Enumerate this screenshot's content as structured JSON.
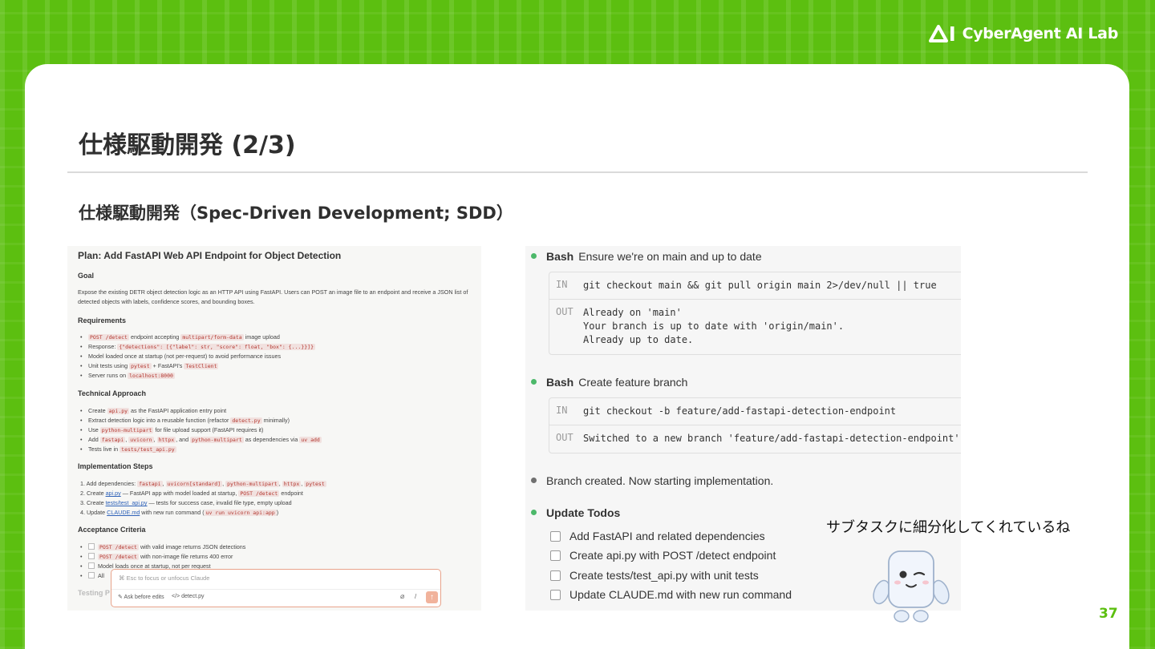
{
  "brand": {
    "logo_text": "CyberAgent AI Lab",
    "accent_color": "#5cbf10"
  },
  "slide": {
    "title": "仕様駆動開発 (2/3)",
    "subtitle": "仕様駆動開発（Spec-Driven Development; SDD）",
    "comment": "サブタスクに細分化してくれているね",
    "page_number": "37"
  },
  "plan": {
    "title": "Plan: Add FastAPI Web API Endpoint for Object Detection",
    "goal_heading": "Goal",
    "goal_text": "Expose the existing DETR object detection logic as an HTTP API using FastAPI. Users can POST an image file to an endpoint and receive a JSON list of detected objects with labels, confidence scores, and bounding boxes.",
    "requirements_heading": "Requirements",
    "technical_heading": "Technical Approach",
    "steps_heading": "Implementation Steps",
    "acceptance_heading": "Acceptance Criteria",
    "testing_heading_partial": "Testing P",
    "req1_code1": "POST /detect",
    "req1_text1": " endpoint accepting ",
    "req1_code2": "multipart/form-data",
    "req1_text2": " image upload",
    "req2_text": "Response: ",
    "req2_code": "{\"detections\": [{\"label\": str, \"score\": float, \"box\": {...}}]}",
    "req3_text": "Model loaded once at startup (not per-request) to avoid performance issues",
    "req4_text1": "Unit tests using ",
    "req4_code1": "pytest",
    "req4_text2": " + FastAPI's ",
    "req4_code2": "TestClient",
    "req5_text": "Server runs on ",
    "req5_code": "localhost:8000",
    "tech1_t1": "Create ",
    "tech1_c1": "api.py",
    "tech1_t2": " as the FastAPI application entry point",
    "tech2_t1": "Extract detection logic into a reusable function (refactor ",
    "tech2_c1": "detect.py",
    "tech2_t2": " minimally)",
    "tech3_t1": "Use ",
    "tech3_c1": "python-multipart",
    "tech3_t2": " for file upload support (FastAPI requires it)",
    "tech4_t1": "Add ",
    "tech4_c1": "fastapi",
    "tech4_c2": "uvicorn",
    "tech4_c3": "httpx",
    "tech4_t2": ", and ",
    "tech4_c4": "python-multipart",
    "tech4_t3": " as dependencies via ",
    "tech4_c5": "uv add",
    "tech5_t1": "Tests live in ",
    "tech5_c1": "tests/test_api.py",
    "step1_t1": "1. Add dependencies: ",
    "step1_c1": "fastapi",
    "step1_c2": "uvicorn[standard]",
    "step1_c3": "python-multipart",
    "step1_c4": "httpx",
    "step1_c5": "pytest",
    "step2_t1": "2. Create ",
    "step2_l1": "api.py",
    "step2_t2": " — FastAPI app with model loaded at startup, ",
    "step2_c1": "POST /detect",
    "step2_t3": " endpoint",
    "step3_t1": "3. Create ",
    "step3_l1": "tests/test_api.py",
    "step3_t2": " — tests for success case, invalid file type, empty upload",
    "step4_t1": "4. Update ",
    "step4_l1": "CLAUDE.md",
    "step4_t2": " with new run command (",
    "step4_c1": "uv run uvicorn api:app",
    "step4_t3": ")",
    "acc1_c": "POST /detect",
    "acc1_t": " with valid image returns JSON detections",
    "acc2_c": "POST /detect",
    "acc2_t": " with non-image file returns 400 error",
    "acc3_t": "Model loads once at startup, not per request",
    "acc4_t": "All",
    "prompt_placeholder": "⌘ Esc to focus or unfocus Claude",
    "ask_mode": "Ask before edits",
    "file_name": "detect.py"
  },
  "terminal": {
    "step1_label": "Bash",
    "step1_desc": "Ensure we're on main and up to date",
    "step1_in_tag": "IN",
    "step1_in": "git checkout main && git pull origin main 2>/dev/null || true",
    "step1_out_tag": "OUT",
    "step1_out": "Already on 'main'\nYour branch is up to date with 'origin/main'.\nAlready up to date.",
    "step2_label": "Bash",
    "step2_desc": "Create feature branch",
    "step2_in_tag": "IN",
    "step2_in": "git checkout -b feature/add-fastapi-detection-endpoint",
    "step2_out_tag": "OUT",
    "step2_out": "Switched to a new branch 'feature/add-fastapi-detection-endpoint'",
    "status_text": "Branch created. Now starting implementation.",
    "todos_label": "Update Todos",
    "todos": [
      "Add FastAPI and related dependencies",
      "Create api.py with POST /detect endpoint",
      "Create tests/test_api.py with unit tests",
      "Update CLAUDE.md with new run command"
    ]
  }
}
